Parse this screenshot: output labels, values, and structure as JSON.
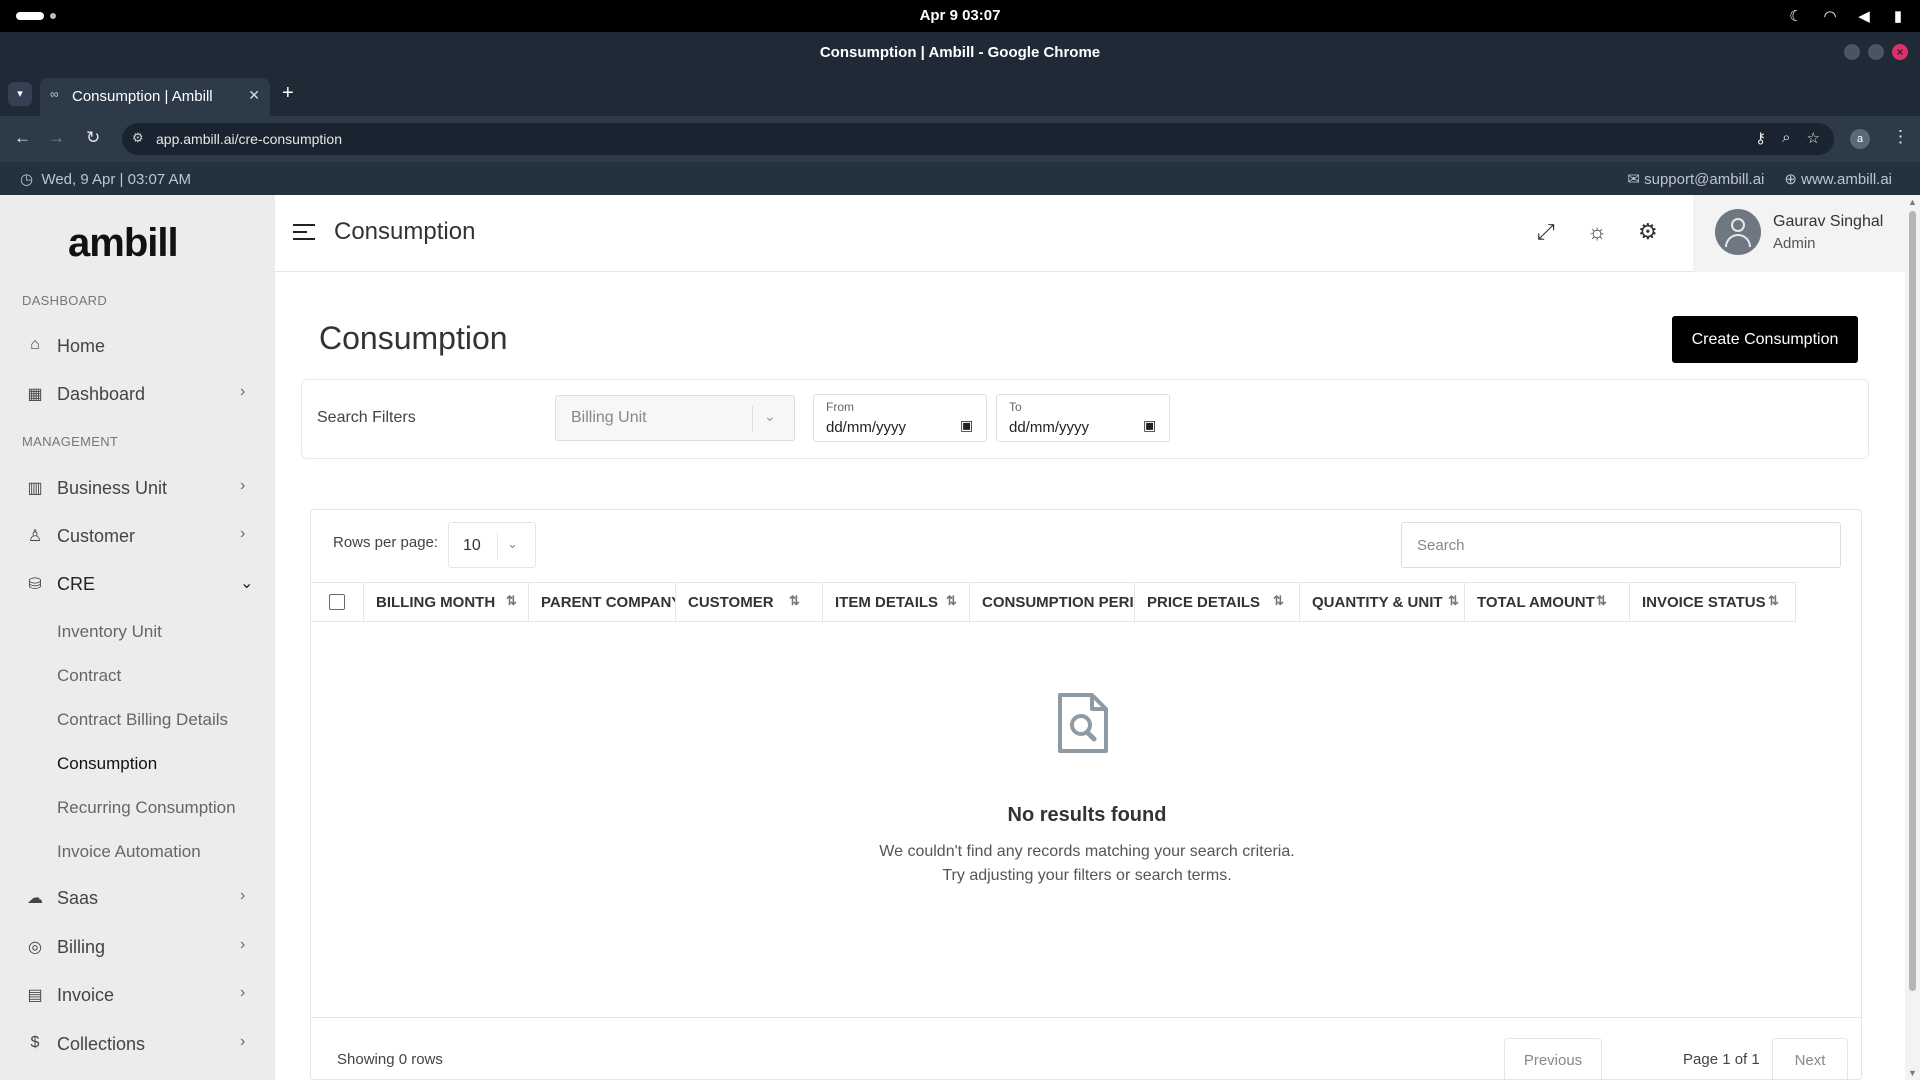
{
  "os": {
    "clock": "Apr 9  03:07",
    "tray_icons": [
      "moon-icon",
      "wifi-icon",
      "volume-icon",
      "battery-icon"
    ]
  },
  "browser": {
    "window_title": "Consumption | Ambill - Google Chrome",
    "tab_title": "Consumption | Ambill",
    "url": "app.ambill.ai/cre-consumption",
    "profile_initial": "a"
  },
  "topline": {
    "datetime": "Wed, 9 Apr | 03:07 AM",
    "email": "support@ambill.ai",
    "website": "www.ambill.ai"
  },
  "sidebar": {
    "logo": "ambill",
    "section_dashboard": "DASHBOARD",
    "section_management": "MANAGEMENT",
    "items": {
      "home": "Home",
      "dashboard": "Dashboard",
      "business_unit": "Business Unit",
      "customer": "Customer",
      "cre": "CRE",
      "saas": "Saas",
      "billing": "Billing",
      "invoice": "Invoice",
      "collections": "Collections"
    },
    "cre_sub": {
      "inventory_unit": "Inventory Unit",
      "contract": "Contract",
      "contract_billing_details": "Contract Billing Details",
      "consumption": "Consumption",
      "recurring_consumption": "Recurring Consumption",
      "invoice_automation": "Invoice Automation"
    }
  },
  "header": {
    "title": "Consumption",
    "user_name": "Gaurav Singhal",
    "user_role": "Admin"
  },
  "page": {
    "title": "Consumption",
    "create_button": "Create Consumption"
  },
  "filters": {
    "label": "Search Filters",
    "billing_unit_placeholder": "Billing Unit",
    "from_label": "From",
    "to_label": "To",
    "date_placeholder": "dd/mm/yyyy"
  },
  "table": {
    "rows_per_page_label": "Rows per page:",
    "rows_per_page_value": "10",
    "search_placeholder": "Search",
    "columns": {
      "billing_month": "BILLING MONTH",
      "parent_company": "PARENT COMPANY",
      "customer": "CUSTOMER",
      "item_details": "ITEM DETAILS",
      "consumption_period": "CONSUMPTION PERIOD",
      "price_details": "PRICE DETAILS",
      "quantity_unit": "QUANTITY & UNIT",
      "total_amount": "TOTAL AMOUNT",
      "invoice_status": "INVOICE STATUS"
    },
    "empty_title": "No results found",
    "empty_line1": "We couldn't find any records matching your search criteria.",
    "empty_line2": "Try adjusting your filters or search terms.",
    "showing": "Showing 0 rows",
    "previous": "Previous",
    "page_info": "Page 1 of 1",
    "next": "Next"
  }
}
